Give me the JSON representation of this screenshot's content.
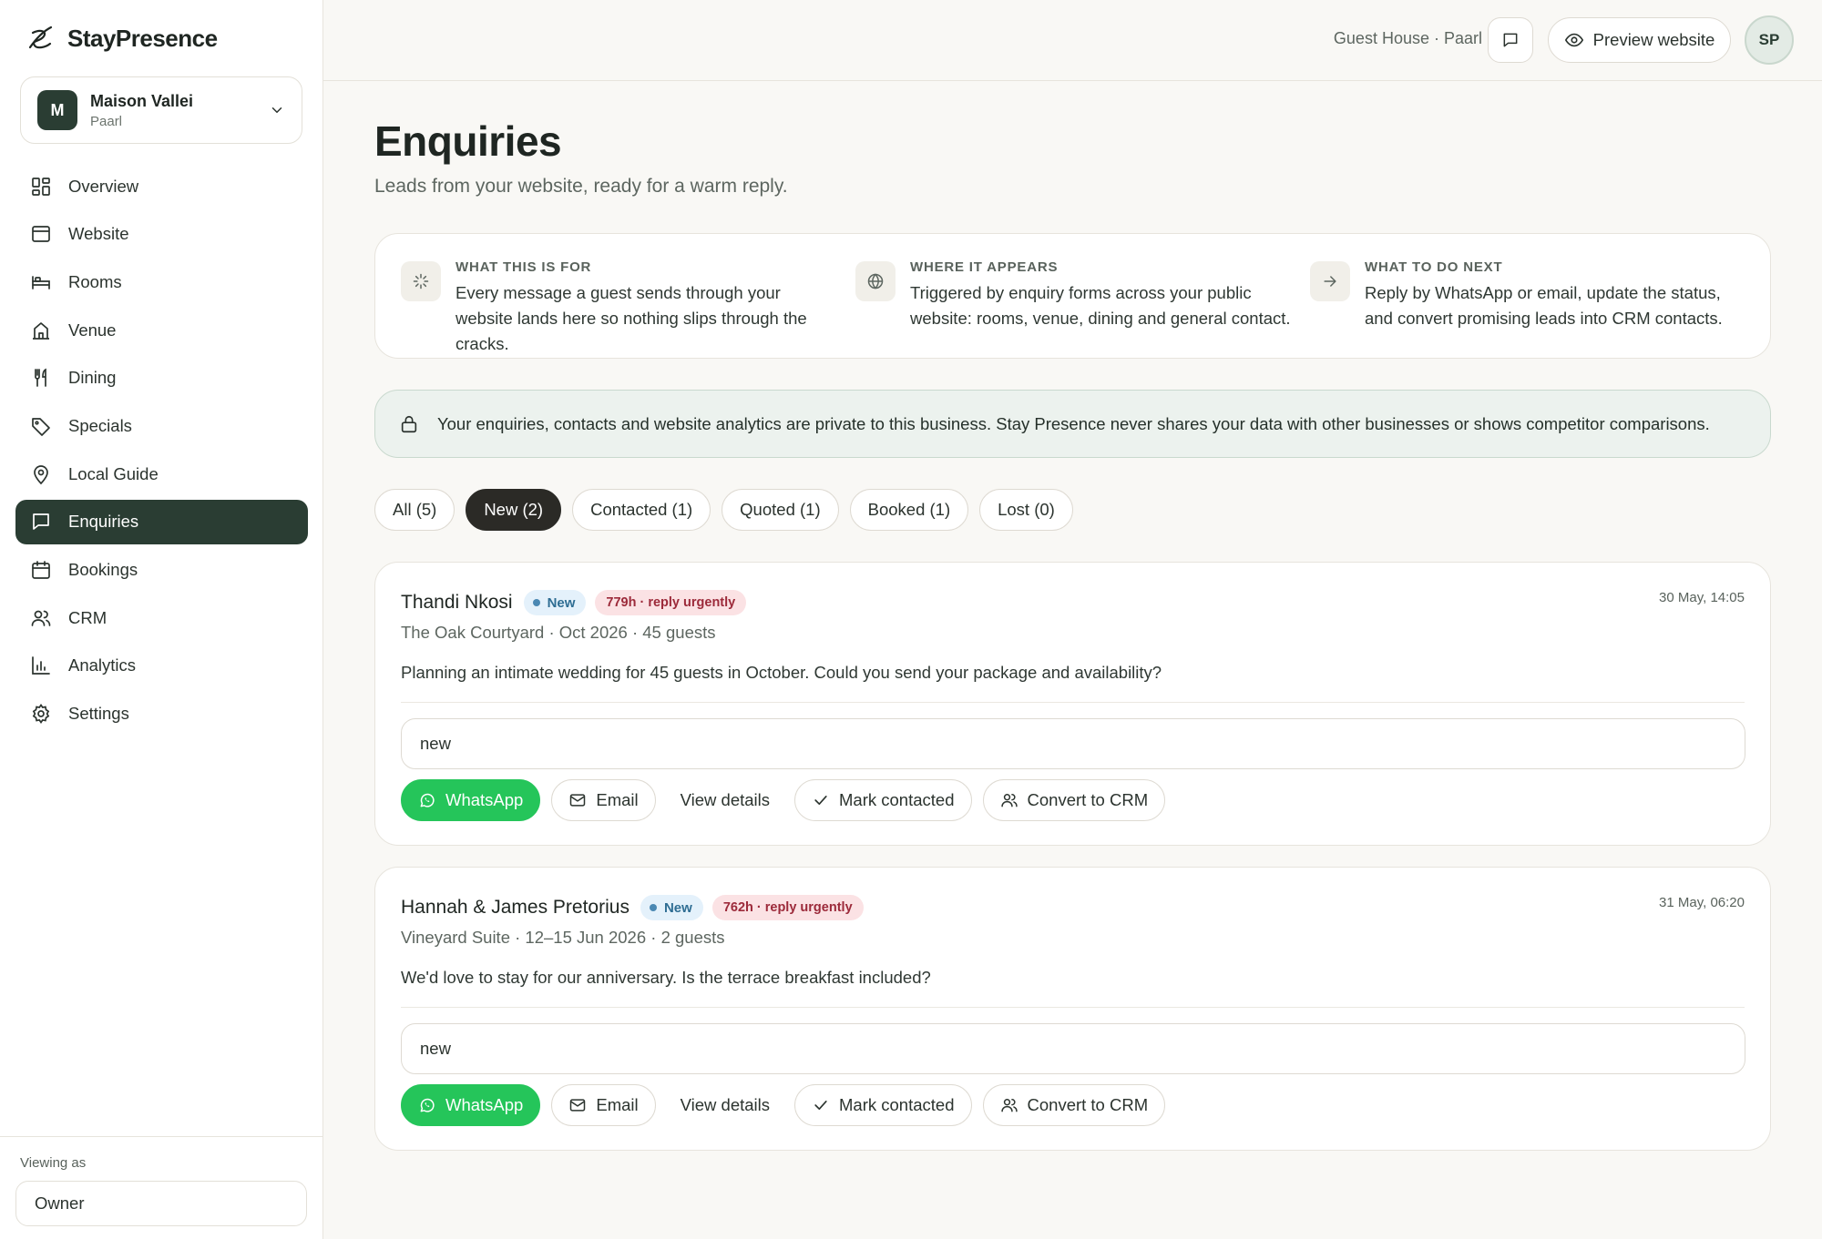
{
  "brand": {
    "name": "StayPresence"
  },
  "property": {
    "initial": "M",
    "name": "Maison Vallei",
    "location": "Paarl"
  },
  "nav": [
    {
      "label": "Overview",
      "icon": "grid-icon"
    },
    {
      "label": "Website",
      "icon": "browser-icon"
    },
    {
      "label": "Rooms",
      "icon": "bed-icon"
    },
    {
      "label": "Venue",
      "icon": "building-icon"
    },
    {
      "label": "Dining",
      "icon": "utensils-icon"
    },
    {
      "label": "Specials",
      "icon": "tag-icon"
    },
    {
      "label": "Local Guide",
      "icon": "map-pin-icon"
    },
    {
      "label": "Enquiries",
      "icon": "message-icon",
      "active": true
    },
    {
      "label": "Bookings",
      "icon": "calendar-icon"
    },
    {
      "label": "CRM",
      "icon": "users-icon"
    },
    {
      "label": "Analytics",
      "icon": "chart-icon"
    },
    {
      "label": "Settings",
      "icon": "gear-icon"
    }
  ],
  "footer": {
    "viewing_label": "Viewing as",
    "role": "Owner"
  },
  "topbar": {
    "business": "Guest House · Paarl",
    "preview_label": "Preview website",
    "avatar": "SP"
  },
  "page": {
    "title": "Enquiries",
    "subtitle": "Leads from your website, ready for a warm reply."
  },
  "info": [
    {
      "heading": "WHAT THIS IS FOR",
      "body": "Every message a guest sends through your website lands here so nothing slips through the cracks."
    },
    {
      "heading": "WHERE IT APPEARS",
      "body": "Triggered by enquiry forms across your public website: rooms, venue, dining and general contact."
    },
    {
      "heading": "WHAT TO DO NEXT",
      "body": "Reply by WhatsApp or email, update the status, and convert promising leads into CRM contacts."
    }
  ],
  "privacy": {
    "text": "Your enquiries, contacts and website analytics are private to this business. Stay Presence never shares your data with other businesses or shows competitor comparisons."
  },
  "filters": [
    {
      "label": "All (5)"
    },
    {
      "label": "New (2)",
      "active": true
    },
    {
      "label": "Contacted (1)"
    },
    {
      "label": "Quoted (1)"
    },
    {
      "label": "Booked (1)"
    },
    {
      "label": "Lost (0)"
    }
  ],
  "actions": {
    "whatsapp": "WhatsApp",
    "email": "Email",
    "details": "View details",
    "contacted": "Mark contacted",
    "convert": "Convert to CRM"
  },
  "enquiries": [
    {
      "name": "Thandi Nkosi",
      "status_badge": "New",
      "urgency": "779h · reply urgently",
      "time": "30 May, 14:05",
      "meta": "The Oak Courtyard · Oct 2026 · 45 guests",
      "message": "Planning an intimate wedding for 45 guests in October. Could you send your package and availability?",
      "status_value": "new"
    },
    {
      "name": "Hannah & James Pretorius",
      "status_badge": "New",
      "urgency": "762h · reply urgently",
      "time": "31 May, 06:20",
      "meta": "Vineyard Suite · 12–15 Jun 2026 · 2 guests",
      "message": "We'd love to stay for our anniversary. Is the terrace breakfast included?",
      "status_value": "new"
    }
  ],
  "colors": {
    "accent": "#2a3d33",
    "whatsapp": "#25c55a",
    "urgent_bg": "#fbe2e4",
    "new_bg": "#e4f1fb"
  }
}
